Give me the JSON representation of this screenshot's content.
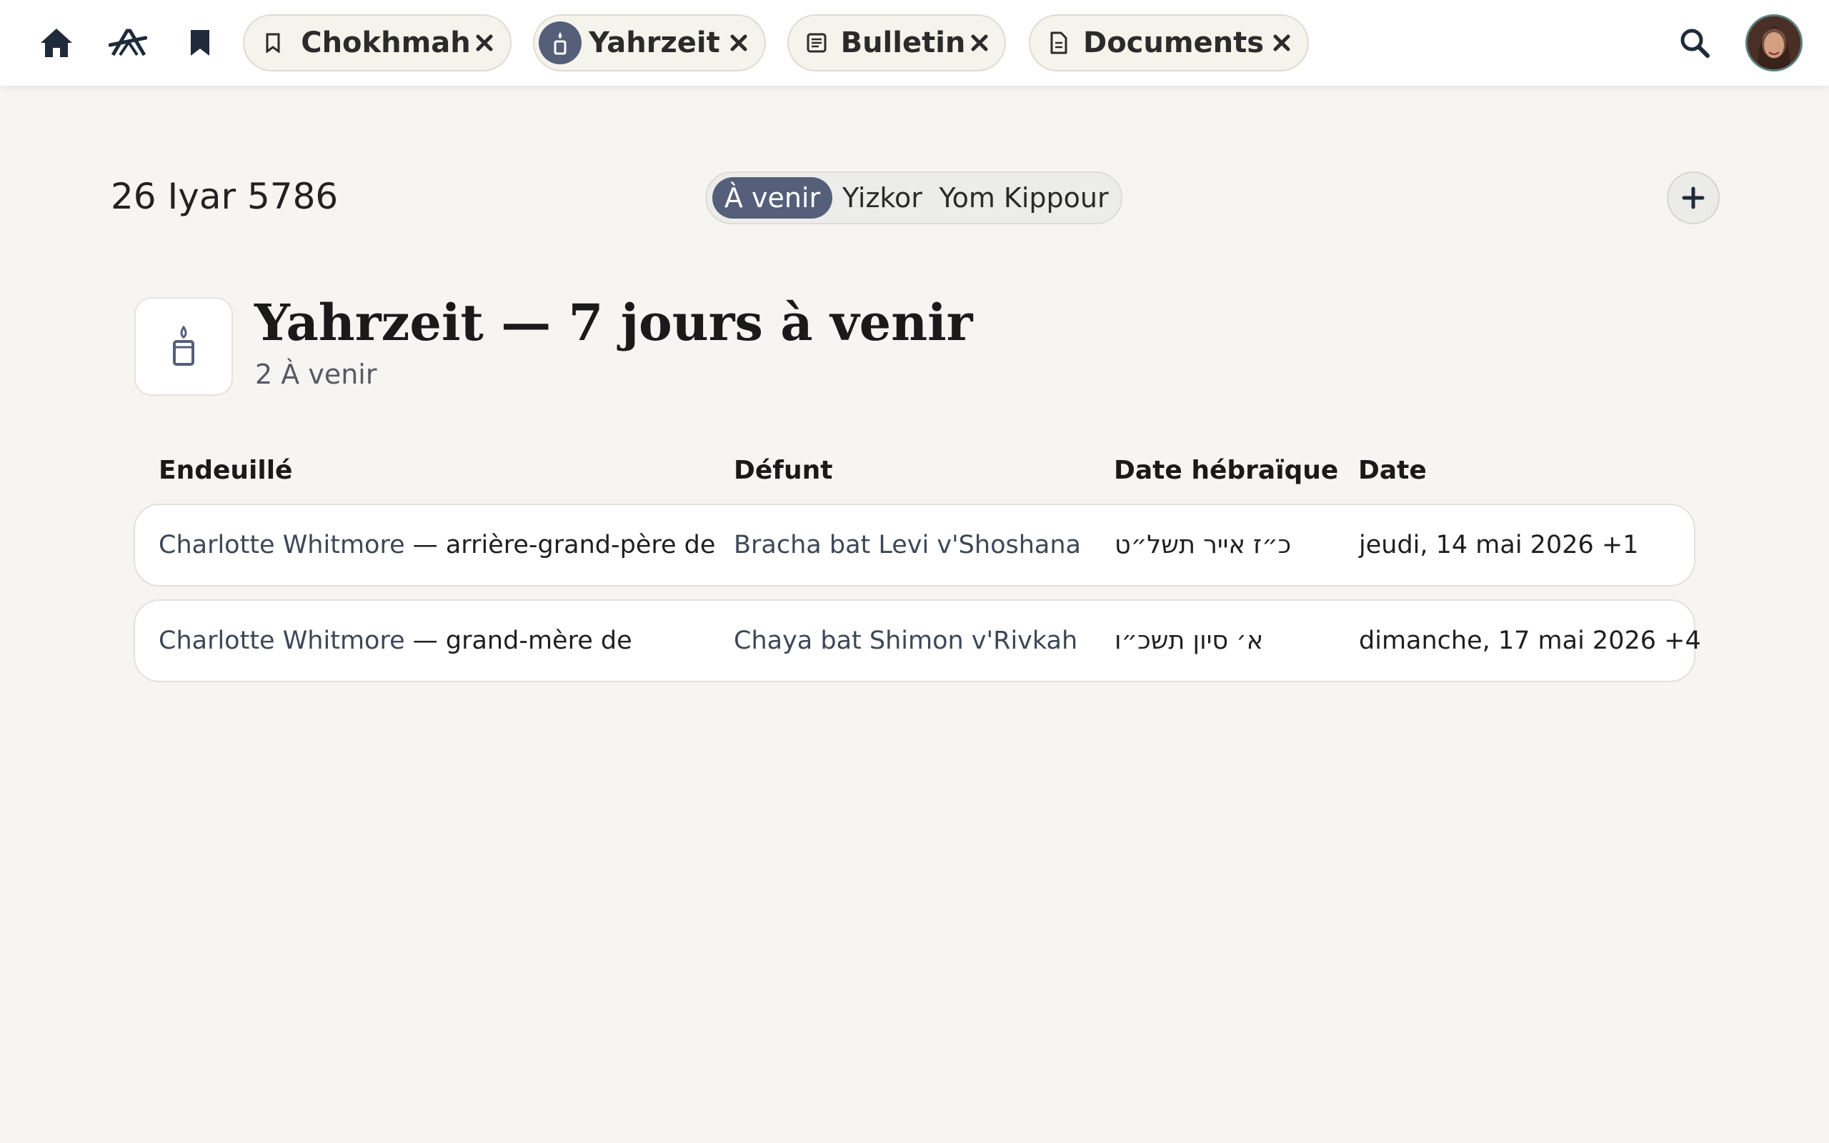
{
  "topbar": {
    "nav_icons": [
      "home-icon",
      "tools-icon",
      "bookmark-icon"
    ],
    "tabs": [
      {
        "label": "Chokhmah",
        "icon": "bookmark-outline-icon",
        "active": false
      },
      {
        "label": "Yahrzeit",
        "icon": "candle-icon",
        "active": true
      },
      {
        "label": "Bulletin",
        "icon": "newspaper-icon",
        "active": false
      },
      {
        "label": "Documents",
        "icon": "document-icon",
        "active": false
      }
    ],
    "search_icon": "search-icon",
    "avatar": "avatar"
  },
  "header": {
    "hebrew_date": "26 Iyar 5786",
    "filters": [
      {
        "label": "À venir",
        "active": true
      },
      {
        "label": "Yizkor",
        "active": false
      },
      {
        "label": "Yom Kippour",
        "active": false
      }
    ],
    "add_label": "+"
  },
  "section": {
    "icon": "candle-icon",
    "title": "Yahrzeit — 7 jours à venir",
    "subtitle": "2 À venir"
  },
  "table": {
    "columns": [
      "Endeuillé",
      "Défunt",
      "Date hébraïque",
      "Date"
    ],
    "rows": [
      {
        "mourner": "Charlotte Whitmore",
        "relation": " — arrière-grand-père de",
        "deceased": "Bracha bat Levi v'Shoshana",
        "hebrew_date": "כ״ז אייר תשל״ט",
        "date": "jeudi, 14 mai 2026 +1"
      },
      {
        "mourner": "Charlotte Whitmore",
        "relation": " — grand-mère de",
        "deceased": "Chaya bat Shimon v'Rivkah",
        "hebrew_date": "א׳ סיון תשכ״ו",
        "date": "dimanche, 17 mai 2026 +4"
      }
    ]
  },
  "colors": {
    "accent": "#555f7a",
    "background": "#f7f5f2",
    "surface": "#ffffff"
  }
}
